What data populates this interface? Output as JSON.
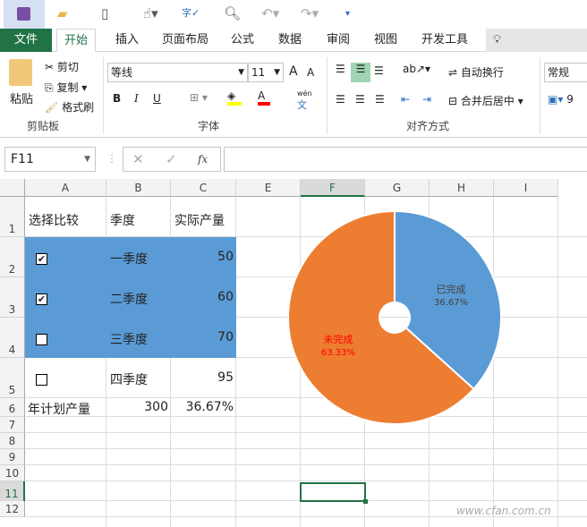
{
  "qat": {
    "icons": [
      "save-icon",
      "open-folder-icon",
      "new-file-icon",
      "touch-mode-icon",
      "spelling-icon",
      "print-preview-icon",
      "undo-icon",
      "redo-icon",
      "customize-icon"
    ]
  },
  "tabs": [
    "文件",
    "开始",
    "插入",
    "页面布局",
    "公式",
    "数据",
    "审阅",
    "视图",
    "开发工具"
  ],
  "ribbon": {
    "clipboard": {
      "paste": "粘贴",
      "cut": "剪切",
      "copy": "复制",
      "format_painter": "格式刷",
      "group": "剪贴板"
    },
    "font": {
      "name": "等线",
      "size": "11",
      "bold": "B",
      "italic": "I",
      "underline": "U",
      "phonetic": "wén",
      "phonetic2": "文",
      "grow": "A",
      "shrink": "A",
      "color_letter": "A",
      "group": "字体"
    },
    "alignment": {
      "wrap": "自动换行",
      "merge": "合并后居中",
      "group": "对齐方式"
    },
    "number": {
      "format": "常规",
      "percent": "9"
    }
  },
  "formula_bar": {
    "name_box": "F11",
    "fx": "fx",
    "cancel": "✕",
    "enter": "✓",
    "value": ""
  },
  "columns": [
    "A",
    "B",
    "C",
    "E",
    "F",
    "G",
    "H",
    "I"
  ],
  "rows": [
    "1",
    "2",
    "3",
    "4",
    "5",
    "6",
    "7",
    "8",
    "9",
    "10",
    "11",
    "12"
  ],
  "cells": {
    "header": [
      "选择比较",
      "季度",
      "实际产量"
    ],
    "data": [
      {
        "checked": true,
        "quarter": "一季度",
        "value": "50"
      },
      {
        "checked": true,
        "quarter": "二季度",
        "value": "60"
      },
      {
        "checked": false,
        "quarter": "三季度",
        "value": "70"
      },
      {
        "checked": false,
        "quarter": "四季度",
        "value": "95"
      }
    ],
    "plan_label": "年计划产量",
    "plan_value": "300",
    "ratio": "36.67%"
  },
  "colors": {
    "accent": "#217346",
    "highlight": "#5B9BD5",
    "done": "#5B9BD5",
    "todo": "#ED7D31"
  },
  "chart_data": {
    "type": "pie",
    "donut": true,
    "categories": [
      "已完成",
      "未完成"
    ],
    "values": [
      36.67,
      63.33
    ],
    "labels": [
      "36.67%",
      "63.33%"
    ],
    "colors": [
      "#5B9BD5",
      "#ED7D31"
    ],
    "label_colors": [
      "#404040",
      "#FF0000"
    ]
  },
  "watermark": "www.cfan.com.cn"
}
